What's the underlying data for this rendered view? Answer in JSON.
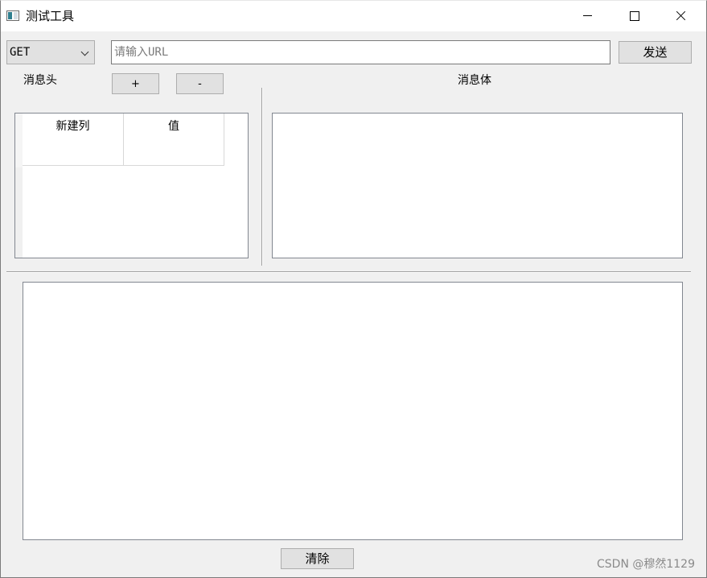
{
  "window": {
    "title": "测试工具",
    "icon": "app-window-icon",
    "controls": {
      "minimize": "minimize-icon",
      "maximize": "maximize-icon",
      "close": "close-icon"
    }
  },
  "request": {
    "method": "GET",
    "method_icon": "chevron-down-icon",
    "url_value": "",
    "url_placeholder": "请输入URL",
    "send_label": "发送"
  },
  "headers": {
    "label": "消息头",
    "add_label": "+",
    "remove_label": "-",
    "columns": [
      "新建列",
      "值"
    ]
  },
  "body_section": {
    "label": "消息体",
    "value": ""
  },
  "response": {
    "value": "",
    "clear_label": "清除"
  },
  "watermark": "CSDN @穆然1129",
  "colors": {
    "window_bg": "#f0f0f0",
    "button_bg": "#e1e1e1",
    "field_border": "#828790"
  }
}
